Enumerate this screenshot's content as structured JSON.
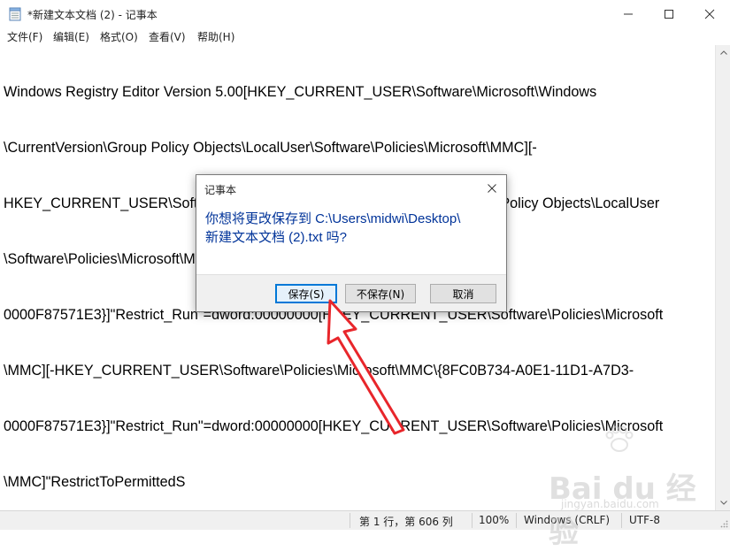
{
  "window": {
    "title": "*新建文本文档 (2) - 记事本",
    "icon": "notepad-icon"
  },
  "menu": [
    {
      "label": "文件(F)"
    },
    {
      "label": "编辑(E)"
    },
    {
      "label": "格式(O)"
    },
    {
      "label": "查看(V)"
    },
    {
      "label": "帮助(H)"
    }
  ],
  "editor": {
    "lines": [
      "Windows Registry Editor Version 5.00[HKEY_CURRENT_USER\\Software\\Microsoft\\Windows",
      "\\CurrentVersion\\Group Policy Objects\\LocalUser\\Software\\Policies\\Microsoft\\MMC][-",
      "HKEY_CURRENT_USER\\Software\\Microsoft\\Windows\\CurrentVersion\\Group Policy Objects\\LocalUser",
      "\\Software\\Policies\\Microsoft\\MMC\\{8FC0B734-A0E1-11D1-A7D3-",
      "0000F87571E3}]\"Restrict_Run\"=dword:00000000[HKEY_CURRENT_USER\\Software\\Policies\\Microsoft",
      "\\MMC][-HKEY_CURRENT_USER\\Software\\Policies\\Microsoft\\MMC\\{8FC0B734-A0E1-11D1-A7D3-",
      "0000F87571E3}]\"Restrict_Run\"=dword:00000000[HKEY_CURRENT_USER\\Software\\Policies\\Microsoft",
      "\\MMC]\"RestrictToPermittedS"
    ]
  },
  "status": {
    "position": "第 1 行，第 606 列",
    "zoom": "100%",
    "line_ending": "Windows (CRLF)",
    "encoding": "UTF-8"
  },
  "dialog": {
    "title": "记事本",
    "message_line1": "你想将更改保存到 C:\\Users\\midwi\\Desktop\\",
    "message_line2": "新建文本文档 (2).txt 吗?",
    "save_label": "保存(S)",
    "dont_save_label": "不保存(N)",
    "cancel_label": "取消"
  },
  "watermark": {
    "text": "Bai du 经验",
    "sub": "jingyan.baidu.com"
  },
  "colors": {
    "accent": "#0078d7",
    "dialog_message": "#003399",
    "annotation_arrow": "#e8262b"
  }
}
